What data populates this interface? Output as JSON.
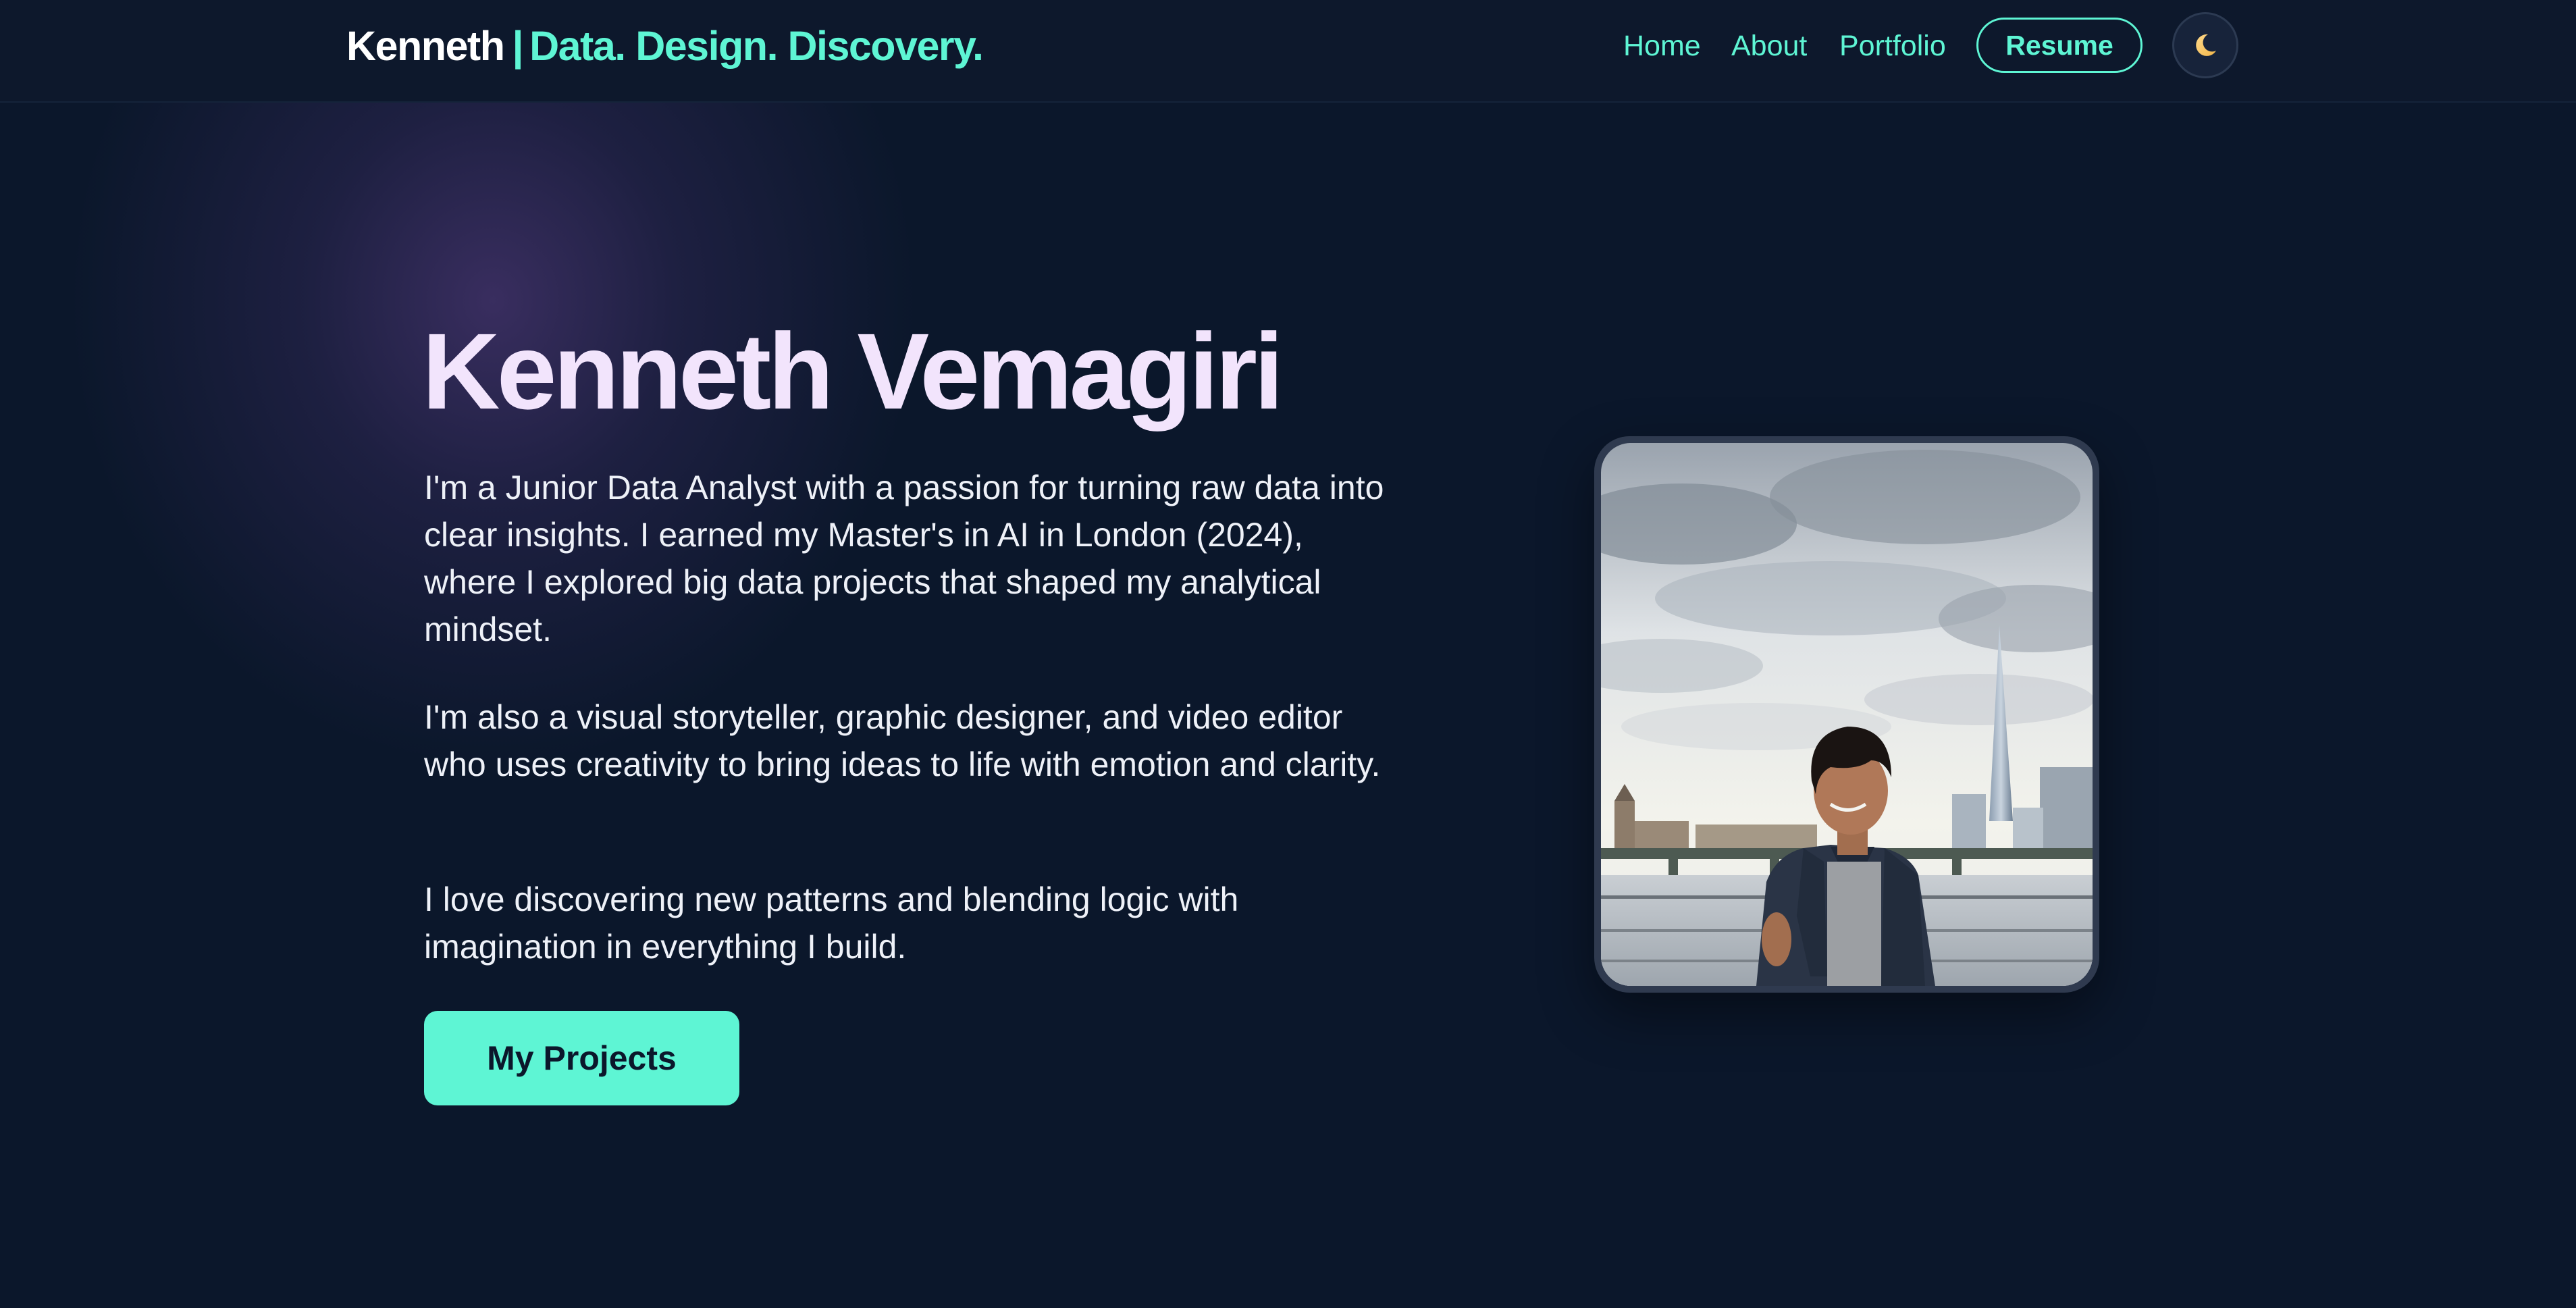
{
  "nav": {
    "brand_name": "Kenneth",
    "brand_separator": "|",
    "brand_tagline": "Data. Design. Discovery.",
    "links": [
      {
        "label": "Home"
      },
      {
        "label": "About"
      },
      {
        "label": "Portfolio"
      }
    ],
    "resume_label": "Resume",
    "theme_toggle_icon": "moon-icon"
  },
  "hero": {
    "title": "Kenneth Vemagiri",
    "paragraphs": [
      "I'm a Junior Data Analyst with a passion for turning raw data into clear insights. I earned my Master's in AI in London (2024), where I explored big data projects that shaped my analytical mindset.",
      "I'm also a visual storyteller, graphic designer, and video editor who uses creativity to bring ideas to life with emotion and clarity.",
      "I love discovering new patterns and blending logic with imagination in everything I build."
    ],
    "cta_label": "My Projects",
    "photo": "profile-photo"
  },
  "colors": {
    "background": "#0b172b",
    "accent": "#5ef5d4",
    "title": "#f2e4fc",
    "text": "#eef1f8"
  }
}
